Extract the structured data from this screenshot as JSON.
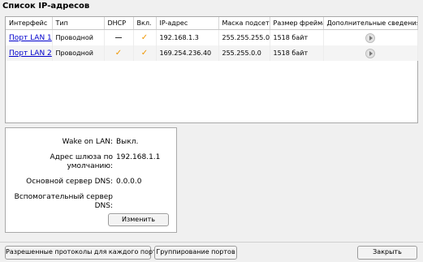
{
  "title": "Список IP-адресов",
  "table": {
    "headers": [
      "Интерфейс",
      "Тип",
      "DHCP",
      "Вкл.",
      "IP-адрес",
      "Маска подсети",
      "Размер фрейма",
      "Дополнительные сведения"
    ],
    "rows": [
      {
        "iface": "Порт LAN 1",
        "type": "Проводной",
        "dhcp": false,
        "enabled": true,
        "ip": "192.168.1.3",
        "mask": "255.255.255.0",
        "frame": "1518 байт"
      },
      {
        "iface": "Порт LAN 2",
        "type": "Проводной",
        "dhcp": true,
        "enabled": true,
        "ip": "169.254.236.40",
        "mask": "255.255.0.0",
        "frame": "1518 байт"
      }
    ]
  },
  "details": {
    "wol_label": "Wake on LAN:",
    "wol_value": "Выкл.",
    "gateway_label_1": "Адрес шлюза по",
    "gateway_label_2": "умолчанию:",
    "gateway_value": "192.168.1.1",
    "dns1_label": "Основной сервер DNS:",
    "dns1_value": "0.0.0.0",
    "dns2_label_1": "Вспомогательный сервер",
    "dns2_label_2": "DNS:",
    "dns2_value": "",
    "change_button": "Изменить"
  },
  "footer": {
    "protocols_button": "Разрешенные протоколы для каждого порта",
    "grouping_button": "Группирование портов",
    "close_button": "Закрыть"
  },
  "colors": {
    "check": "#f09600",
    "link": "#0000cc"
  },
  "icons": {
    "enabled": "check-icon",
    "dhcp_off": "dash-icon",
    "more": "play-icon"
  }
}
